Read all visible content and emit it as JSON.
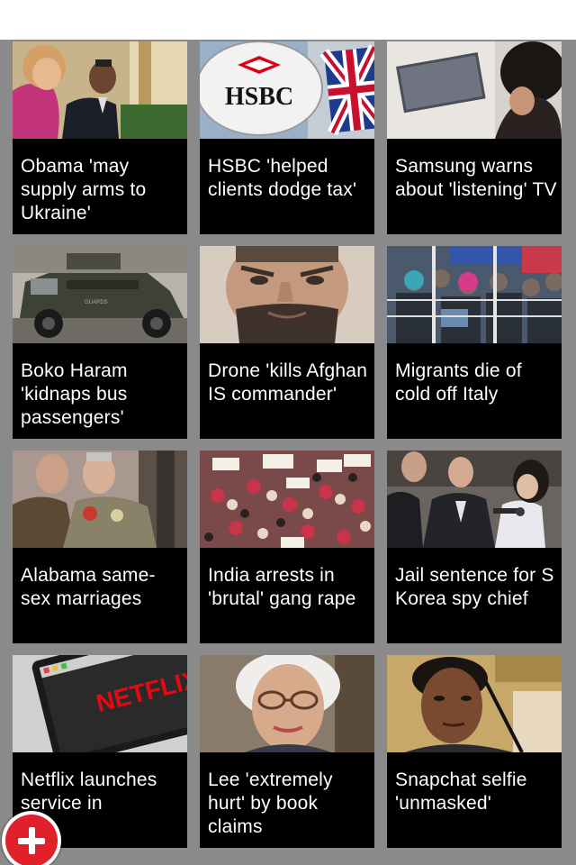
{
  "stories": [
    {
      "headline": "Obama 'may supply arms to Ukraine'",
      "image": "leaders-meeting-photo"
    },
    {
      "headline": "HSBC 'helped clients dodge tax'",
      "image": "hsbc-sign-photo"
    },
    {
      "headline": "Samsung warns about 'listening' TV",
      "image": "tv-viewer-photo"
    },
    {
      "headline": "Boko Haram 'kidnaps bus passengers'",
      "image": "armoured-vehicle-photo"
    },
    {
      "headline": "Drone 'kills Afghan IS commander'",
      "image": "commander-portrait-photo"
    },
    {
      "headline": "Migrants die of cold off Italy",
      "image": "migrant-boat-photo"
    },
    {
      "headline": "Alabama same-sex marriages",
      "image": "couple-kiss-photo"
    },
    {
      "headline": "India arrests in 'brutal' gang rape",
      "image": "protest-crowd-photo"
    },
    {
      "headline": "Jail sentence for S Korea spy chief",
      "image": "press-scrum-photo"
    },
    {
      "headline": "Netflix launches service in",
      "image": "netflix-screen-photo"
    },
    {
      "headline": "Lee 'extremely hurt' by book claims",
      "image": "author-portrait-photo"
    },
    {
      "headline": "Snapchat selfie 'unmasked'",
      "image": "selfie-portrait-photo"
    }
  ],
  "thumbnail_text": {
    "hsbc": "HSBC",
    "netflix": "NETFLIX"
  },
  "icons": {
    "fab": "add-icon"
  },
  "colors": {
    "grid_background": "#8a8a8a",
    "card_background": "#000000",
    "headline_text": "#ffffff",
    "fab_accent": "#e0202a"
  }
}
